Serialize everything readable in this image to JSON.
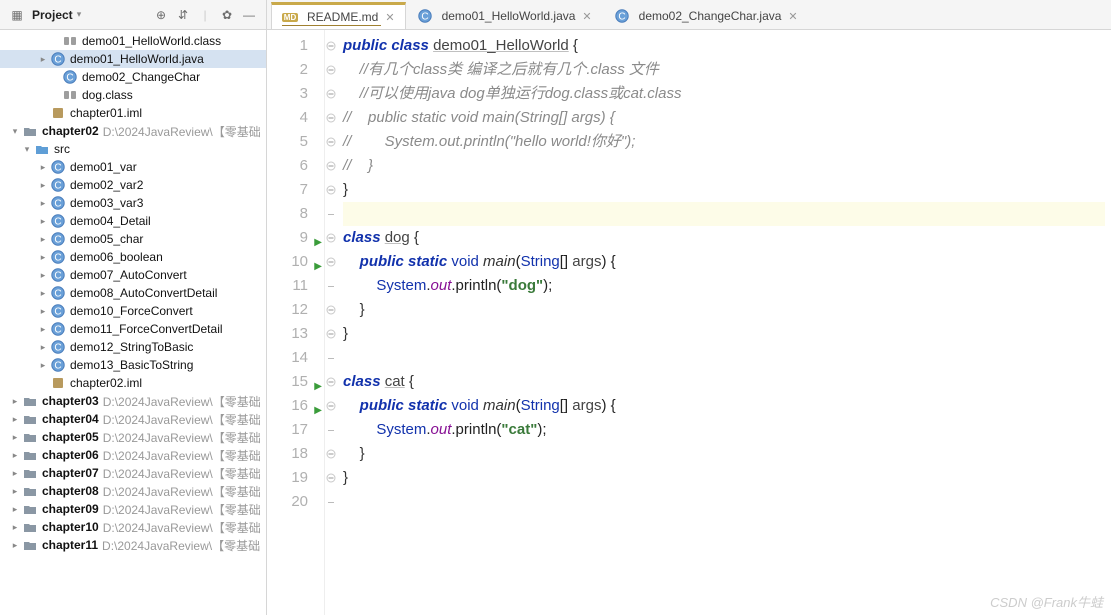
{
  "sidebar": {
    "title": "Project"
  },
  "tabs": [
    {
      "label": "README.md",
      "icon": "md",
      "active": true
    },
    {
      "label": "demo01_HelloWorld.java",
      "icon": "java"
    },
    {
      "label": "demo02_ChangeChar.java",
      "icon": "java"
    }
  ],
  "tree": [
    {
      "indent": 48,
      "arrow": "none",
      "icon": "class",
      "label": "demo01_HelloWorld.class"
    },
    {
      "indent": 36,
      "arrow": "right",
      "icon": "java",
      "label": "demo01_HelloWorld.java",
      "selected": true
    },
    {
      "indent": 48,
      "arrow": "none",
      "icon": "java",
      "label": "demo02_ChangeChar"
    },
    {
      "indent": 48,
      "arrow": "none",
      "icon": "class",
      "label": "dog.class"
    },
    {
      "indent": 36,
      "arrow": "none",
      "icon": "iml",
      "label": "chapter01.iml"
    },
    {
      "indent": 8,
      "arrow": "down",
      "icon": "folder",
      "label": "chapter02",
      "bold": true,
      "path": "D:\\2024JavaReview\\【零基础"
    },
    {
      "indent": 20,
      "arrow": "down",
      "icon": "src",
      "label": "src"
    },
    {
      "indent": 36,
      "arrow": "right",
      "icon": "java",
      "label": "demo01_var"
    },
    {
      "indent": 36,
      "arrow": "right",
      "icon": "java",
      "label": "demo02_var2"
    },
    {
      "indent": 36,
      "arrow": "right",
      "icon": "java",
      "label": "demo03_var3"
    },
    {
      "indent": 36,
      "arrow": "right",
      "icon": "java",
      "label": "demo04_Detail"
    },
    {
      "indent": 36,
      "arrow": "right",
      "icon": "java",
      "label": "demo05_char"
    },
    {
      "indent": 36,
      "arrow": "right",
      "icon": "java",
      "label": "demo06_boolean"
    },
    {
      "indent": 36,
      "arrow": "right",
      "icon": "java",
      "label": "demo07_AutoConvert"
    },
    {
      "indent": 36,
      "arrow": "right",
      "icon": "java",
      "label": "demo08_AutoConvertDetail"
    },
    {
      "indent": 36,
      "arrow": "right",
      "icon": "java",
      "label": "demo10_ForceConvert"
    },
    {
      "indent": 36,
      "arrow": "right",
      "icon": "java",
      "label": "demo11_ForceConvertDetail"
    },
    {
      "indent": 36,
      "arrow": "right",
      "icon": "java",
      "label": "demo12_StringToBasic"
    },
    {
      "indent": 36,
      "arrow": "right",
      "icon": "java",
      "label": "demo13_BasicToString"
    },
    {
      "indent": 36,
      "arrow": "none",
      "icon": "iml",
      "label": "chapter02.iml"
    },
    {
      "indent": 8,
      "arrow": "right",
      "icon": "folder",
      "label": "chapter03",
      "bold": true,
      "path": "D:\\2024JavaReview\\【零基础"
    },
    {
      "indent": 8,
      "arrow": "right",
      "icon": "folder",
      "label": "chapter04",
      "bold": true,
      "path": "D:\\2024JavaReview\\【零基础"
    },
    {
      "indent": 8,
      "arrow": "right",
      "icon": "folder",
      "label": "chapter05",
      "bold": true,
      "path": "D:\\2024JavaReview\\【零基础"
    },
    {
      "indent": 8,
      "arrow": "right",
      "icon": "folder",
      "label": "chapter06",
      "bold": true,
      "path": "D:\\2024JavaReview\\【零基础"
    },
    {
      "indent": 8,
      "arrow": "right",
      "icon": "folder",
      "label": "chapter07",
      "bold": true,
      "path": "D:\\2024JavaReview\\【零基础"
    },
    {
      "indent": 8,
      "arrow": "right",
      "icon": "folder",
      "label": "chapter08",
      "bold": true,
      "path": "D:\\2024JavaReview\\【零基础"
    },
    {
      "indent": 8,
      "arrow": "right",
      "icon": "folder",
      "label": "chapter09",
      "bold": true,
      "path": "D:\\2024JavaReview\\【零基础"
    },
    {
      "indent": 8,
      "arrow": "right",
      "icon": "folder",
      "label": "chapter10",
      "bold": true,
      "path": "D:\\2024JavaReview\\【零基础"
    },
    {
      "indent": 8,
      "arrow": "right",
      "icon": "folder",
      "label": "chapter11",
      "bold": true,
      "path": "D:\\2024JavaReview\\【零基础"
    }
  ],
  "code": {
    "lines": [
      {
        "n": 1,
        "tokens": [
          [
            "kw",
            "public "
          ],
          [
            "kw",
            "class "
          ],
          [
            "name und",
            "demo01_HelloWorld"
          ],
          [
            "brace",
            " {"
          ]
        ]
      },
      {
        "n": 2,
        "tokens": [
          [
            "",
            "    "
          ],
          [
            "cmt",
            "//有几个class类 编译之后就有几个.class 文件"
          ]
        ]
      },
      {
        "n": 3,
        "tokens": [
          [
            "",
            "    "
          ],
          [
            "cmt",
            "//可以使用java dog单独运行dog.class或cat.class"
          ]
        ]
      },
      {
        "n": 4,
        "tokens": [
          [
            "cmt",
            "//    public static void main(String[] args) {"
          ]
        ]
      },
      {
        "n": 5,
        "tokens": [
          [
            "cmt",
            "//        System.out.println(\"hello world!你好\");"
          ]
        ]
      },
      {
        "n": 6,
        "tokens": [
          [
            "cmt",
            "//    }"
          ]
        ]
      },
      {
        "n": 7,
        "tokens": [
          [
            "brace",
            "}"
          ]
        ]
      },
      {
        "n": 8,
        "tokens": [
          [
            "",
            ""
          ]
        ],
        "hi": true
      },
      {
        "n": 9,
        "run": true,
        "tokens": [
          [
            "kw",
            "class "
          ],
          [
            "name und",
            "dog"
          ],
          [
            "brace",
            " {"
          ]
        ]
      },
      {
        "n": 10,
        "run": true,
        "tokens": [
          [
            "",
            "    "
          ],
          [
            "kw",
            "public static "
          ],
          [
            "type",
            "void "
          ],
          [
            "fn",
            "main"
          ],
          [
            "",
            "("
          ],
          [
            "type",
            "String"
          ],
          [
            "",
            "[] "
          ],
          [
            "name",
            "args"
          ],
          [
            "",
            ") {"
          ]
        ]
      },
      {
        "n": 11,
        "tokens": [
          [
            "",
            "        "
          ],
          [
            "type",
            "System"
          ],
          [
            "",
            "."
          ],
          [
            "pur",
            "out"
          ],
          [
            "",
            ".println("
          ],
          [
            "str",
            "\"dog\""
          ],
          [
            "",
            ");"
          ]
        ]
      },
      {
        "n": 12,
        "tokens": [
          [
            "",
            "    "
          ],
          [
            "brace",
            "}"
          ]
        ]
      },
      {
        "n": 13,
        "tokens": [
          [
            "brace",
            "}"
          ]
        ]
      },
      {
        "n": 14,
        "tokens": [
          [
            "",
            ""
          ]
        ]
      },
      {
        "n": 15,
        "run": true,
        "tokens": [
          [
            "kw",
            "class "
          ],
          [
            "name und",
            "cat"
          ],
          [
            "brace",
            " {"
          ]
        ]
      },
      {
        "n": 16,
        "run": true,
        "tokens": [
          [
            "",
            "    "
          ],
          [
            "kw",
            "public static "
          ],
          [
            "type",
            "void "
          ],
          [
            "fn",
            "main"
          ],
          [
            "",
            "("
          ],
          [
            "type",
            "String"
          ],
          [
            "",
            "[] "
          ],
          [
            "name",
            "args"
          ],
          [
            "",
            ") {"
          ]
        ]
      },
      {
        "n": 17,
        "tokens": [
          [
            "",
            "        "
          ],
          [
            "type",
            "System"
          ],
          [
            "",
            "."
          ],
          [
            "pur",
            "out"
          ],
          [
            "",
            ".println("
          ],
          [
            "str",
            "\"cat\""
          ],
          [
            "",
            ");"
          ]
        ]
      },
      {
        "n": 18,
        "tokens": [
          [
            "",
            "    "
          ],
          [
            "brace",
            "}"
          ]
        ]
      },
      {
        "n": 19,
        "tokens": [
          [
            "brace",
            "}"
          ]
        ]
      },
      {
        "n": 20,
        "tokens": [
          [
            "",
            ""
          ]
        ]
      }
    ]
  },
  "watermark": "CSDN @Frank牛蛙"
}
